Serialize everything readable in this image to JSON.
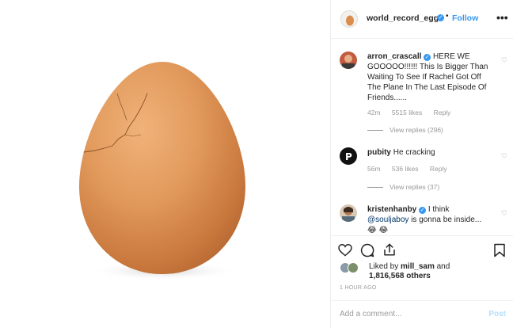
{
  "post": {
    "username": "world_record_egg",
    "follow_label": "Follow",
    "separator": "•",
    "more_icon": "more-dots-icon"
  },
  "comments": [
    {
      "username": "arron_crascall",
      "verified": true,
      "text": "HERE WE GOOOOO!!!!!! This Is Bigger Than Waiting To See If Rachel Got Off The Plane In The Last Episode Of Friends......",
      "age": "42m",
      "likes": "5515 likes",
      "reply_label": "Reply",
      "view_replies": "View replies (296)"
    },
    {
      "username": "pubity",
      "verified": false,
      "text": "He cracking",
      "age": "56m",
      "likes": "536 likes",
      "reply_label": "Reply",
      "view_replies": "View replies (37)"
    },
    {
      "username": "kristenhanby",
      "verified": true,
      "text_pre": "I think",
      "mention": "@souljaboy",
      "text_post": "is gonna be inside...",
      "emoji": "😂 😂"
    }
  ],
  "likes": {
    "liked_by_prefix": "Liked by",
    "liked_by_user": "mill_sam",
    "and_label": "and",
    "count": "1,816,568 others"
  },
  "timestamp": "1 HOUR AGO",
  "add_comment": {
    "placeholder": "Add a comment...",
    "post_label": "Post"
  },
  "colors": {
    "link_blue": "#3897f0",
    "muted_gray": "#999999",
    "post_disabled": "#b2dffc",
    "egg": "#d98d4e"
  }
}
